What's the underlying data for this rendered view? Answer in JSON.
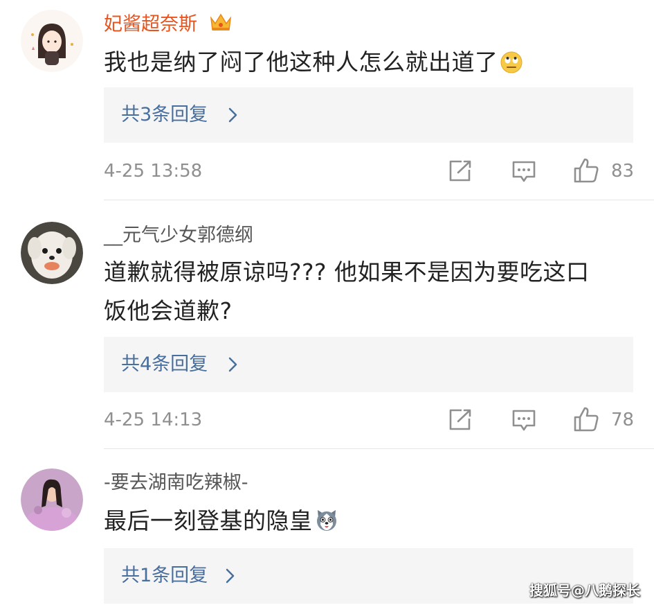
{
  "comments": [
    {
      "username": "妃酱超奈斯",
      "content": "我也是纳了闷了他这种人怎么就出道了",
      "content_emoji": "eye-roll-emoji",
      "replies_label": "共3条回复",
      "time": "4-25 13:58",
      "likes": "83",
      "badge_icon": "crown-vip-icon"
    },
    {
      "username": "__元气少女郭德纲",
      "content_line1": "道歉就得被原谅吗??? 他如果不是因为要吃这口",
      "content_line2": "饭他会道歉?",
      "replies_label": "共4条回复",
      "time": "4-25 14:13",
      "likes": "78"
    },
    {
      "username": "-要去湖南吃辣椒-",
      "content": "最后一刻登基的隐皇",
      "content_emoji": "husky-dog-emoji",
      "replies_label": "共1条回复"
    }
  ],
  "watermark": "搜狐号@八鹅探长",
  "colors": {
    "vip_name": "#e8541e",
    "reply_link": "#486e9d",
    "meta_gray": "#8f8f8f",
    "reply_bg": "#f5f5f5"
  }
}
